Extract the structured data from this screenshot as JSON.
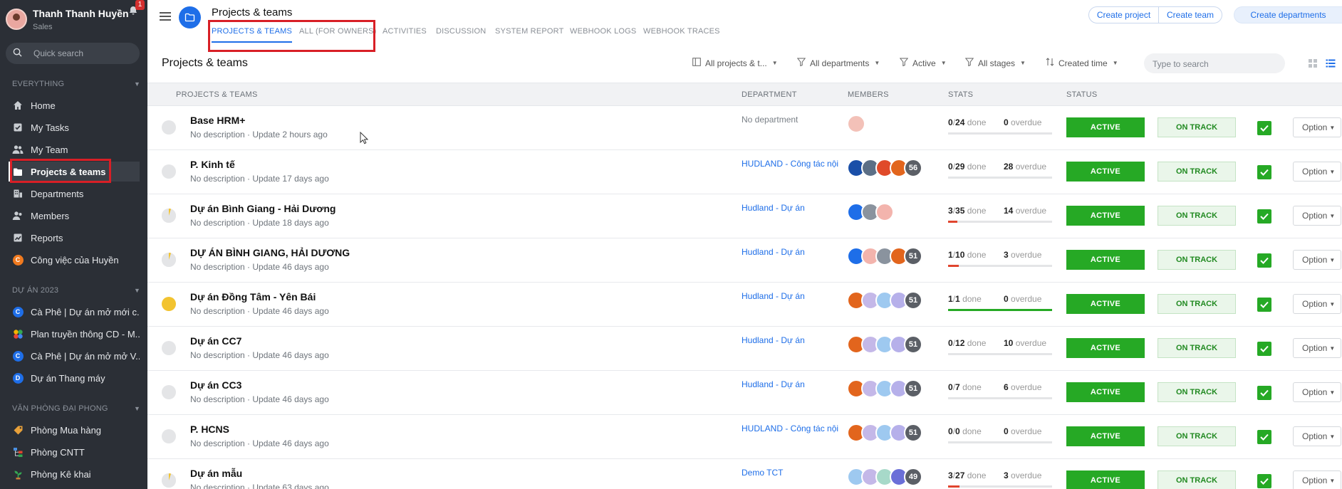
{
  "user": {
    "name": "Thanh Thanh Huyền",
    "role": "Sales",
    "notifications": "1"
  },
  "search": {
    "placeholder": "Quick search"
  },
  "sidebar": {
    "everything_title": "EVERYTHING",
    "items": [
      {
        "label": "Home",
        "icon": "home-icon"
      },
      {
        "label": "My Tasks",
        "icon": "tasks-icon"
      },
      {
        "label": "My Team",
        "icon": "team-icon"
      },
      {
        "label": "Projects & teams",
        "icon": "folder-icon",
        "active": true
      },
      {
        "label": "Departments",
        "icon": "departments-icon"
      },
      {
        "label": "Members",
        "icon": "members-icon"
      },
      {
        "label": "Reports",
        "icon": "reports-icon"
      },
      {
        "label": "Công việc của Huyền",
        "icon": "orange-c-badge",
        "badge": "C",
        "badge_color": "#f07a1f"
      }
    ],
    "projects_title": "DỰ ÁN 2023",
    "projects": [
      {
        "label": "Cà Phê | Dự án mở mới c...",
        "badge": "C",
        "badge_color": "#1e6ee8"
      },
      {
        "label": "Plan truyền thông CD - M...",
        "icon": "colorful-icon"
      },
      {
        "label": "Cà Phê | Dự án mở mở V...",
        "badge": "C",
        "badge_color": "#1e6ee8"
      },
      {
        "label": "Dự án Thang máy",
        "badge": "D",
        "badge_color": "#1e6ee8"
      }
    ],
    "office_title": "VĂN PHÒNG ĐẠI PHONG",
    "office": [
      {
        "label": "Phòng Mua hàng",
        "icon": "tag-icon"
      },
      {
        "label": "Phòng CNTT",
        "icon": "hierarchy-icon"
      },
      {
        "label": "Phòng Kê khai",
        "icon": "plant-icon"
      }
    ]
  },
  "header": {
    "title": "Projects & teams",
    "tabs": [
      "PROJECTS & TEAMS",
      "ALL (FOR OWNERS)",
      "ACTIVITIES",
      "DISCUSSION",
      "SYSTEM REPORT",
      "WEBHOOK LOGS",
      "WEBHOOK TRACES"
    ],
    "create_project": "Create project",
    "create_team": "Create team",
    "create_departments": "Create departments"
  },
  "toolbar": {
    "section_title": "Projects & teams",
    "filters": [
      "All projects & t...",
      "All departments",
      "Active",
      "All stages",
      "Created time"
    ],
    "search_placeholder": "Type to search"
  },
  "table": {
    "columns": [
      "PROJECTS & TEAMS",
      "DEPARTMENT",
      "MEMBERS",
      "STATS",
      "STATUS"
    ],
    "status_label": "ACTIVE",
    "track_label": "ON TRACK",
    "option_label": "Option",
    "done_label": "done",
    "overdue_label": "overdue",
    "rows": [
      {
        "name": "Base HRM+",
        "desc": "No description · Update 2 hours ago",
        "dept": "No department",
        "dept_none": true,
        "done": "0",
        "total": "24",
        "overdue": "0",
        "progress": 0,
        "bar_color": "#e4e5e7",
        "circle": "empty",
        "avatars": [
          "#f3c1b8"
        ],
        "count": ""
      },
      {
        "name": "P. Kinh tế",
        "desc": "No description · Update 17 days ago",
        "dept": "HUDLAND - Công tác nội",
        "done": "0",
        "total": "29",
        "overdue": "28",
        "progress": 0,
        "bar_color": "#e4e5e7",
        "circle": "empty",
        "avatars": [
          "#1a4fa8",
          "#5c6f86",
          "#e04a2a",
          "#e2651d"
        ],
        "count": "56"
      },
      {
        "name": "Dự án Bình Giang - Hải Dương",
        "desc": "No description · Update 18 days ago",
        "dept": "Hudland - Dự án",
        "done": "3",
        "total": "35",
        "overdue": "14",
        "progress": 0.0857,
        "bar_color": "#e0452e",
        "circle": "partial",
        "avatars": [
          "#1e6ee8",
          "#8a939e",
          "#f3b4ad"
        ],
        "count": ""
      },
      {
        "name": "DỰ ÁN BÌNH GIANG, HẢI DƯƠNG",
        "desc": "No description · Update 46 days ago",
        "dept": "Hudland - Dự án",
        "done": "1",
        "total": "10",
        "overdue": "3",
        "progress": 0.1,
        "bar_color": "#e0452e",
        "circle": "partial",
        "avatars": [
          "#1e6ee8",
          "#f3b4ad",
          "#8a939e",
          "#e2651d"
        ],
        "count": "51"
      },
      {
        "name": "Dự án Đồng Tâm - Yên Bái",
        "desc": "No description · Update 46 days ago",
        "dept": "Hudland - Dự án",
        "done": "1",
        "total": "1",
        "overdue": "0",
        "progress": 1,
        "bar_color": "#26a925",
        "circle": "full",
        "avatars": [
          "#e2651d",
          "#c4b8e8",
          "#9ec9f0",
          "#b6b0ea"
        ],
        "count": "51"
      },
      {
        "name": "Dự án CC7",
        "desc": "No description · Update 46 days ago",
        "dept": "Hudland - Dự án",
        "done": "0",
        "total": "12",
        "overdue": "10",
        "progress": 0,
        "bar_color": "#e4e5e7",
        "circle": "empty",
        "avatars": [
          "#e2651d",
          "#c4b8e8",
          "#9ec9f0",
          "#b6b0ea"
        ],
        "count": "51"
      },
      {
        "name": "Dự án CC3",
        "desc": "No description · Update 46 days ago",
        "dept": "Hudland - Dự án",
        "done": "0",
        "total": "7",
        "overdue": "6",
        "progress": 0,
        "bar_color": "#e4e5e7",
        "circle": "empty",
        "avatars": [
          "#e2651d",
          "#c4b8e8",
          "#9ec9f0",
          "#b6b0ea"
        ],
        "count": "51"
      },
      {
        "name": "P. HCNS",
        "desc": "No description · Update 46 days ago",
        "dept": "HUDLAND - Công tác nội",
        "done": "0",
        "total": "0",
        "overdue": "0",
        "progress": 0,
        "bar_color": "#e4e5e7",
        "circle": "empty",
        "avatars": [
          "#e2651d",
          "#c4b8e8",
          "#9ec9f0",
          "#b6b0ea"
        ],
        "count": "51"
      },
      {
        "name": "Dự án mẫu",
        "desc": "No description · Update 63 days ago",
        "dept": "Demo TCT",
        "done": "3",
        "total": "27",
        "overdue": "3",
        "progress": 0.111,
        "bar_color": "#e0452e",
        "circle": "partial",
        "avatars": [
          "#9ec9f0",
          "#c4b8e8",
          "#a7d9c9",
          "#6b6fd8"
        ],
        "count": "49"
      }
    ]
  }
}
